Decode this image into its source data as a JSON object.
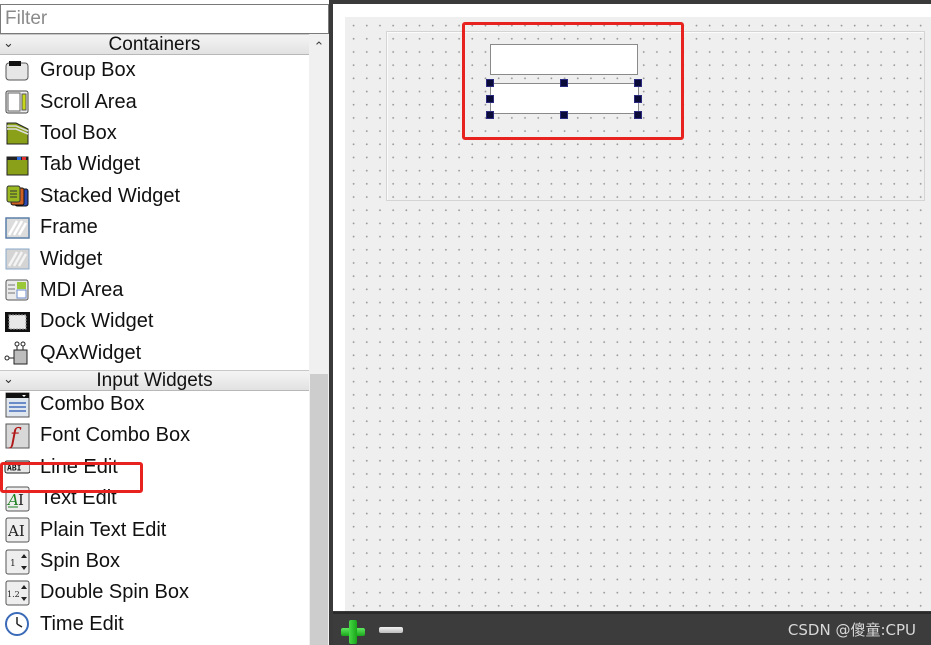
{
  "filter": {
    "placeholder": "Filter",
    "value": ""
  },
  "categories": [
    {
      "label": "Containers",
      "expanded": true,
      "items": [
        {
          "label": "Group Box",
          "icon": "group-box-icon"
        },
        {
          "label": "Scroll Area",
          "icon": "scroll-area-icon"
        },
        {
          "label": "Tool Box",
          "icon": "tool-box-icon"
        },
        {
          "label": "Tab Widget",
          "icon": "tab-widget-icon"
        },
        {
          "label": "Stacked Widget",
          "icon": "stacked-widget-icon"
        },
        {
          "label": "Frame",
          "icon": "frame-icon"
        },
        {
          "label": "Widget",
          "icon": "widget-icon"
        },
        {
          "label": "MDI Area",
          "icon": "mdi-area-icon"
        },
        {
          "label": "Dock Widget",
          "icon": "dock-widget-icon"
        },
        {
          "label": "QAxWidget",
          "icon": "qaxwidget-icon"
        }
      ]
    },
    {
      "label": "Input Widgets",
      "expanded": true,
      "items": [
        {
          "label": "Combo Box",
          "icon": "combo-box-icon"
        },
        {
          "label": "Font Combo Box",
          "icon": "font-combo-box-icon"
        },
        {
          "label": "Line Edit",
          "icon": "line-edit-icon",
          "highlighted": true
        },
        {
          "label": "Text Edit",
          "icon": "text-edit-icon"
        },
        {
          "label": "Plain Text Edit",
          "icon": "plain-text-edit-icon"
        },
        {
          "label": "Spin Box",
          "icon": "spin-box-icon"
        },
        {
          "label": "Double Spin Box",
          "icon": "double-spin-box-icon"
        },
        {
          "label": "Time Edit",
          "icon": "time-edit-icon"
        }
      ]
    }
  ],
  "form": {
    "line_edits": [
      {
        "name": "line-edit-1",
        "value": "",
        "selected": false
      },
      {
        "name": "line-edit-2",
        "value": "",
        "selected": true
      }
    ]
  },
  "colors": {
    "highlight": "#e8231f",
    "selection_handle": "#0b0b3a",
    "add_green": "#1aa61a"
  },
  "bottom_bar": {
    "add_icon": "plus-icon",
    "remove_icon": "minus-icon",
    "watermark": "CSDN @傻童:CPU"
  }
}
